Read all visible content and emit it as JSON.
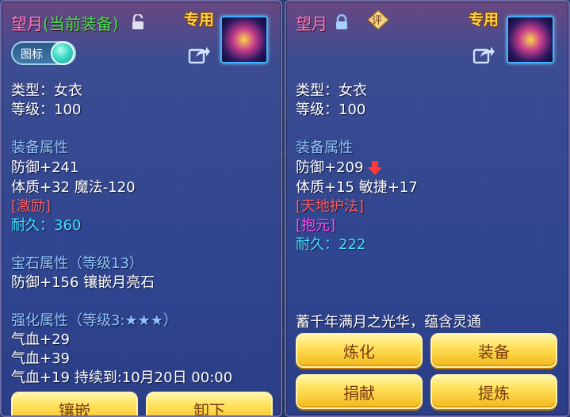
{
  "left_panel": {
    "item_name": "望月",
    "item_status": "(当前装备)",
    "special_tag": "专用",
    "toggle_label": "图标",
    "type_line": "类型：女衣",
    "level_line": "等级：100",
    "equip_attr_title": "装备属性",
    "defense": "防御+241",
    "attr_line": "体质+32 魔法-120",
    "special_effect": "[激励]",
    "durability": "耐久：360",
    "gem_title": "宝石属性（等级13）",
    "gem_line": "防御+156 镶嵌月亮石",
    "enhance_title": "强化属性（等级3:★★★）",
    "hp_lines": [
      "气血+29",
      "气血+39",
      "气血+19   持续到:10月20日 00:00"
    ],
    "buttons": [
      "镶嵌",
      "卸下"
    ]
  },
  "right_panel": {
    "item_name": "望月",
    "eval_badge": "评",
    "special_tag": "专用",
    "type_line": "类型：女衣",
    "level_line": "等级：100",
    "equip_attr_title": "装备属性",
    "defense": "防御+209",
    "attr_line": "体质+15 敏捷+17",
    "special_skill": "[天地护法]",
    "special_effect": "[抱元]",
    "durability": "耐久：222",
    "description": "蓄千年满月之光华，蕴含灵通",
    "buttons": [
      "炼化",
      "装备",
      "捐献",
      "提炼"
    ]
  },
  "colors": {
    "name_pink": "#ff7ec0",
    "status_green": "#45e04a",
    "section_blue": "#8fc4ff",
    "value_cyan": "#3fe3ff",
    "effect_red": "#ff5d5d",
    "effect_magenta": "#ff4df0",
    "button_gold": "#ffe05a"
  },
  "icons": [
    "lock-open-icon",
    "lock-closed-icon",
    "share-icon",
    "item-icon",
    "down-arrow-icon",
    "eval-badge-icon"
  ]
}
